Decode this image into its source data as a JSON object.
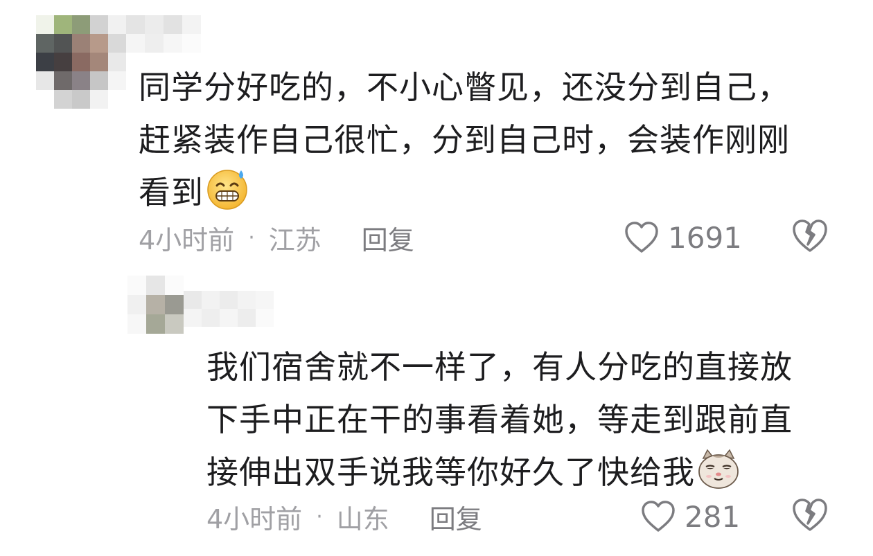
{
  "comments": [
    {
      "text": "同学分好吃的，不小心瞥见，还没分到自己，\n赶紧装作自己很忙，分到自己时，会装作刚刚\n看到",
      "emoji": "grinning-sweat-emoji",
      "time": "4小时前",
      "dot": "·",
      "location": "江苏",
      "reply_label": "回复",
      "like_count": "1691",
      "like_icon": "heart-outline-icon",
      "dislike_icon": "broken-heart-icon"
    },
    {
      "text": "我们宿舍就不一样了，有人分吃的直接放\n下手中正在干的事看着她，等走到跟前直\n接伸出双手说我等你好久了快给我",
      "emoji": "smug-cat-emoji",
      "time": "4小时前",
      "dot": "·",
      "location": "山东",
      "reply_label": "回复",
      "like_count": "281",
      "like_icon": "heart-outline-icon",
      "dislike_icon": "broken-heart-icon"
    }
  ],
  "colors": {
    "text": "#1d1d1f",
    "meta": "#a0a0a4",
    "action": "#7c7c80"
  },
  "mosaics": {
    "avatar_1": [
      "#f0f3ea",
      "#9fb57b",
      "#8d9c78",
      "#d2d2d2",
      "#f1f1f1",
      "#5f6563",
      "#525454",
      "#9b8176",
      "#b79a8a",
      "#d9d9d9",
      "#3c3f45",
      "#463f40",
      "#8a6a62",
      "#a4877a",
      "#e9e9e9",
      "#e7e7e7",
      "#6f6a6a",
      "#8a8287",
      "#c6c6c6",
      "#f5f5f5",
      "#ffffff",
      "#d3d3d3",
      "#c9c9c9",
      "#f2f2f2",
      "#ffffff"
    ],
    "name_1": [
      "#e4e4e4",
      "#ececec",
      "#e2e2e2",
      "#f3f3f3",
      "#f5f5f5",
      "#eeeeee",
      "#f6f6f6",
      "#fbfbfb"
    ],
    "avatar_2": [
      "#fafafa",
      "#e6e6e6",
      "#fbfbfb",
      "#f0f0f0",
      "#b6b1a6",
      "#9a9a92",
      "#f7f7f7",
      "#a5a897",
      "#c9c9c0"
    ],
    "name_2": [
      "#e9e9e9",
      "#f2f2f2",
      "#ececec",
      "#f3f3f3",
      "#f6f6f6",
      "#f4f4f4",
      "#eeeeee",
      "#f5f5f5",
      "#ededed",
      "#fafafa"
    ]
  }
}
